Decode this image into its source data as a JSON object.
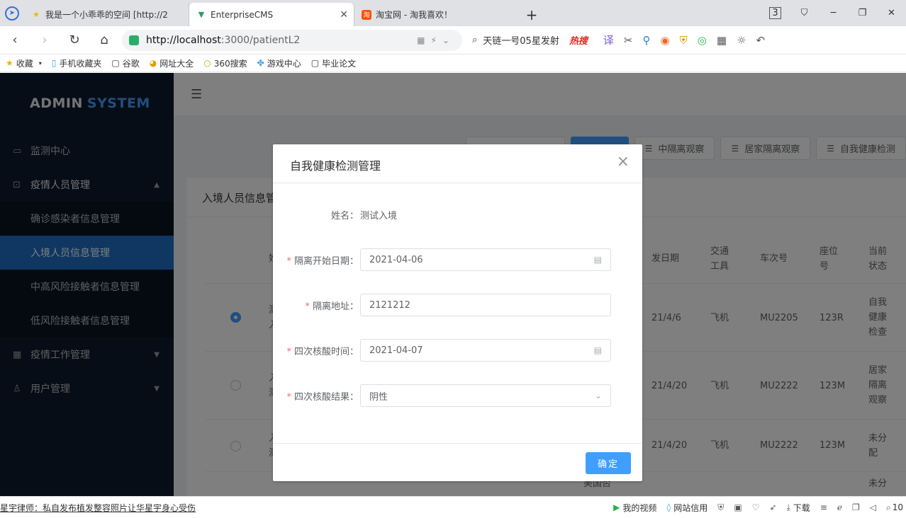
{
  "browser": {
    "tabs": [
      {
        "title": "我是一个小乖乖的空间 [http://2",
        "icon": "star-icon"
      },
      {
        "title": "EnterpriseCMS",
        "icon": "vue-icon"
      },
      {
        "title": "淘宝网 - 淘我喜欢！",
        "icon": "taobao-icon"
      }
    ],
    "new_tab": "+",
    "tab_count": "3",
    "url_host": "http://localhost",
    "url_rest": ":3000/patientL2",
    "search_text": "天链一号05星发射",
    "hot_label": "热搜",
    "bookmarks": [
      "收藏",
      "手机收藏夹",
      "谷歌",
      "网址大全",
      "360搜索",
      "游戏中心",
      "毕业论文"
    ]
  },
  "app": {
    "logo_main": "ADMIN",
    "logo_accent": "SYSTEM",
    "menu": {
      "monitor": "监测中心",
      "epidemic_people": "疫情人员管理",
      "confirmed": "确诊感染者信息管理",
      "inbound": "入境人员信息管理",
      "high_risk": "中高风险接触者信息管理",
      "low_risk": "低风险接触者信息管理",
      "epidemic_work": "疫情工作管理",
      "users": "用户管理"
    },
    "toolbar": {
      "centralized": "中隔离观察",
      "home_isolation": "居家隔离观察",
      "self_check": "自我健康检测"
    },
    "card_title": "入境人员信息管",
    "table": {
      "headers": {
        "name": "姓名",
        "date": "发日期",
        "transport": "交通工具",
        "train": "车次号",
        "seat": "座位号",
        "state": "当前状态"
      },
      "rows": [
        {
          "name": "测试入境",
          "date": "21/4/6",
          "transport": "飞机",
          "train": "MU2205",
          "seat": "123R",
          "state": "自我健康检查"
        },
        {
          "name": "入境测试",
          "date": "21/4/20",
          "transport": "飞机",
          "train": "MU2222",
          "seat": "123M",
          "state": "居家隔离观察"
        },
        {
          "name": "入境测试",
          "date": "21/4/20",
          "transport": "飞机",
          "train": "MU2222",
          "seat": "123M",
          "state": "未分配"
        }
      ],
      "partial_row": {
        "country": "美国否",
        "state": "未分"
      }
    }
  },
  "dialog": {
    "title": "自我健康检测管理",
    "close": "×",
    "name_label": "姓名：",
    "name_value": "测试入境",
    "start_date_label": "隔离开始日期：",
    "start_date_value": "2021-04-06",
    "address_label": "隔离地址：",
    "address_value": "2121212",
    "test_time_label": "四次核酸时间：",
    "test_time_value": "2021-04-07",
    "test_result_label": "四次核酸结果：",
    "test_result_value": "阴性",
    "confirm": "确定"
  },
  "statusbar": {
    "news": "星宇律师：私自发布植发整容照片让华星宇身心受伤",
    "my_video": "我的视频",
    "site_trust": "网站信用",
    "download": "下载",
    "zoom": "10"
  },
  "colors": {
    "sidebar_bg": "#0f1b2c",
    "active_menu": "#1f6fc5",
    "primary": "#409eff",
    "required": "#f56c6c"
  }
}
